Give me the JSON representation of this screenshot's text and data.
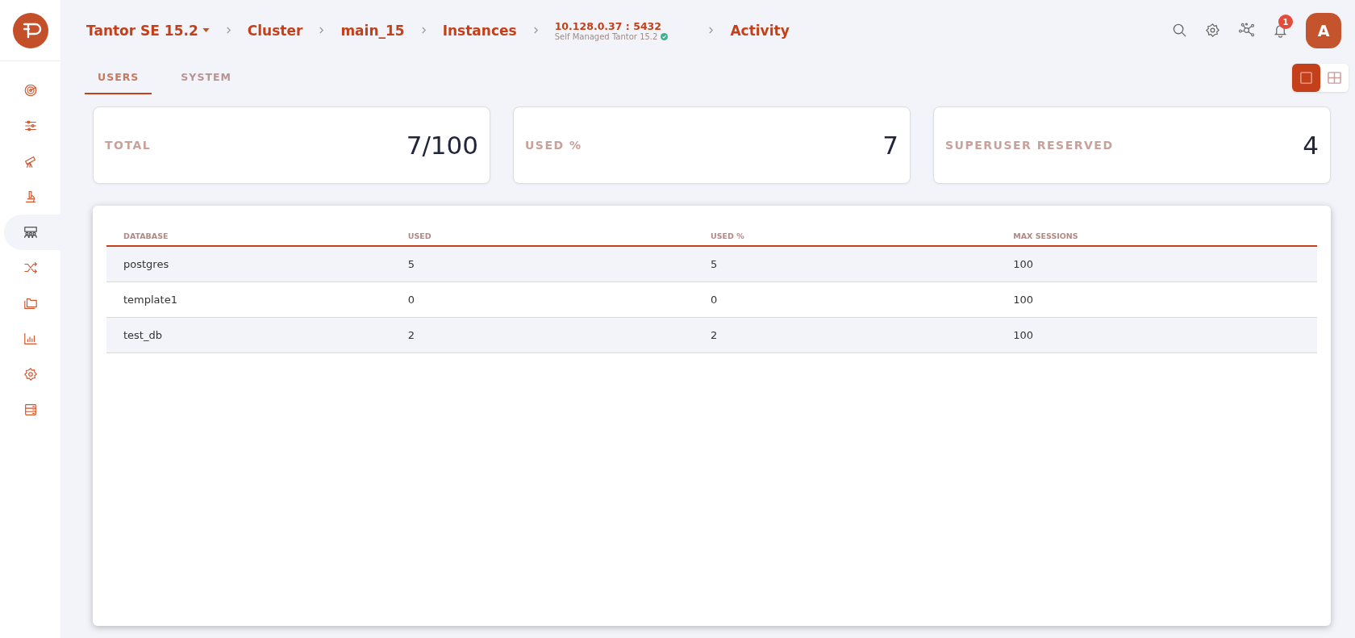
{
  "sidebar": {
    "items": [
      {
        "selected": false
      },
      {
        "selected": false
      },
      {
        "selected": false
      },
      {
        "selected": false
      },
      {
        "selected": true
      },
      {
        "selected": false
      },
      {
        "selected": false
      },
      {
        "selected": false
      },
      {
        "selected": false
      },
      {
        "selected": false
      }
    ]
  },
  "breadcrumbs": [
    {
      "kind": "dropdown",
      "label": "Tantor SE 15.2"
    },
    {
      "kind": "link",
      "label": "Cluster"
    },
    {
      "kind": "link",
      "label": "main_15"
    },
    {
      "kind": "link",
      "label": "Instances"
    },
    {
      "kind": "instance",
      "label": "10.128.0.37 : 5432",
      "subtitle": "Self Managed Tantor 15.2",
      "verified": true
    },
    {
      "kind": "link",
      "label": "Activity"
    }
  ],
  "header": {
    "notifications": "1",
    "avatar": "A"
  },
  "tabs": [
    {
      "label": "USERS",
      "selected": true
    },
    {
      "label": "SYSTEM",
      "selected": false
    }
  ],
  "view_toggle": [
    {
      "kind": "single",
      "selected": true
    },
    {
      "kind": "grid",
      "selected": false
    }
  ],
  "stats": [
    {
      "label": "TOTAL",
      "value": "7/100"
    },
    {
      "label": "USED %",
      "value": "7"
    },
    {
      "label": "SUPERUSER RESERVED",
      "value": "4"
    }
  ],
  "table": {
    "columns": [
      "DATABASE",
      "USED",
      "USED %",
      "MAX SESSIONS"
    ],
    "rows": [
      [
        "postgres",
        "5",
        "5",
        "100"
      ],
      [
        "template1",
        "0",
        "0",
        "100"
      ],
      [
        "test_db",
        "2",
        "2",
        "100"
      ]
    ]
  }
}
